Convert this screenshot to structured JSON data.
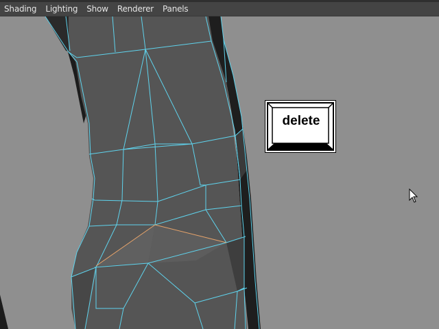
{
  "menubar": {
    "items": [
      {
        "label": "Shading"
      },
      {
        "label": "Lighting"
      },
      {
        "label": "Show"
      },
      {
        "label": "Renderer"
      },
      {
        "label": "Panels"
      }
    ]
  },
  "key_overlay": {
    "label": "delete"
  },
  "colors": {
    "viewport_background": "#8f8f8f",
    "mesh_fill": "#555555",
    "wireframe": "#5fd4ee",
    "selected_edges": "#e8a46a"
  },
  "icons": {
    "cursor": "arrow-cursor-icon"
  }
}
